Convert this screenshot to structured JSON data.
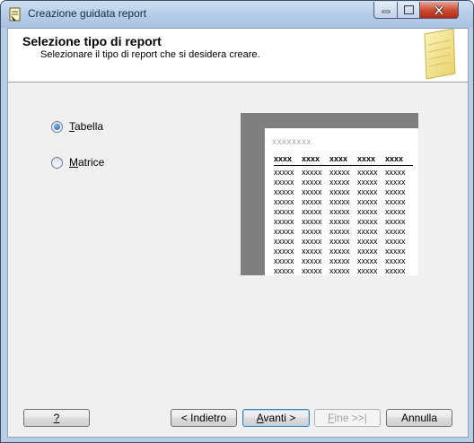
{
  "window": {
    "title": "Creazione guidata report"
  },
  "header": {
    "title": "Selezione tipo di report",
    "subtitle": "Selezionare il tipo di report che si desidera creare."
  },
  "options": [
    {
      "label": "Tabella",
      "accel": "T",
      "rest": "abella",
      "checked": true
    },
    {
      "label": "Matrice",
      "accel": "M",
      "rest": "atrice",
      "checked": false
    }
  ],
  "preview": {
    "title": "xxxxxxxx",
    "header_row": [
      "xxxx",
      "xxxx",
      "xxxx",
      "xxxx",
      "xxxx"
    ],
    "cell": "xxxxx",
    "row_count": 11,
    "col_count": 5
  },
  "buttons": {
    "help": "?",
    "back": "< Indietro",
    "next": "Avanti >",
    "finish": "Fine >>|",
    "cancel": "Annulla"
  }
}
